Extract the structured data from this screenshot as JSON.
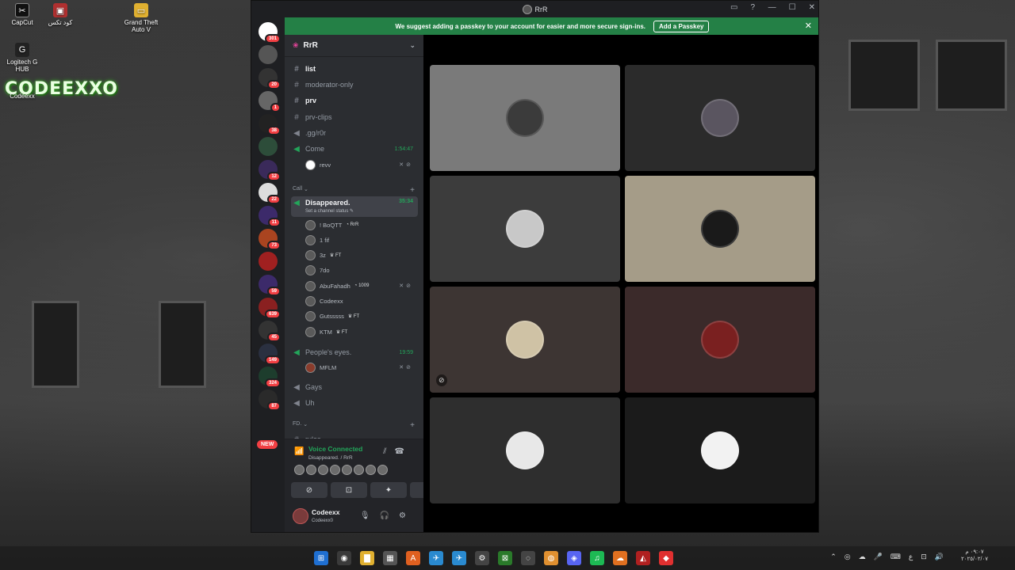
{
  "desktop": {
    "icons": [
      {
        "label": "CapCut",
        "glyph": "✂"
      },
      {
        "label": "كود تكس",
        "glyph": "▣"
      },
      {
        "label": "Grand Theft Auto V",
        "glyph": "▭"
      },
      {
        "label": "Logitech G HUB",
        "glyph": "G"
      },
      {
        "label": "Codeexx",
        "glyph": "●"
      }
    ],
    "wallpaper_logo": "CODEEXXO"
  },
  "window": {
    "title": "RrR",
    "controls": {
      "minimize": "—",
      "maximize": "☐",
      "close": "✕"
    },
    "extras": {
      "inbox": "▭",
      "help": "?"
    }
  },
  "banner": {
    "text": "We suggest adding a passkey to your account for easier and more secure sign-ins.",
    "button": "Add a Passkey",
    "close": "✕"
  },
  "servers": [
    {
      "badge": "301"
    },
    {
      "badge": ""
    },
    {
      "badge": "20"
    },
    {
      "badge": "1"
    },
    {
      "badge": "38"
    },
    {
      "badge": ""
    },
    {
      "badge": "12"
    },
    {
      "badge": "22"
    },
    {
      "badge": "11"
    },
    {
      "badge": "73"
    },
    {
      "badge": ""
    },
    {
      "badge": "59"
    },
    {
      "badge": "639"
    },
    {
      "badge": "45"
    },
    {
      "badge": "149"
    },
    {
      "badge": "324"
    },
    {
      "badge": "87"
    }
  ],
  "servers_new": "NEW",
  "guild": {
    "name": "RrR",
    "chevron": "⌄"
  },
  "channels": [
    {
      "type": "text",
      "name": "list",
      "bright": true
    },
    {
      "type": "text",
      "name": "moderator-only",
      "bright": false
    },
    {
      "type": "text",
      "name": "prv",
      "bright": true
    },
    {
      "type": "text",
      "name": "prv-clips",
      "bright": false
    },
    {
      "type": "text",
      "name": ".gg/r0r",
      "bright": false
    },
    {
      "type": "voice",
      "name": "Come",
      "time": "1:54:47"
    }
  ],
  "come_members": [
    {
      "name": "revv",
      "icons": "✕⊘"
    }
  ],
  "category_call": "Call",
  "selected_channel": {
    "name": "Disappeared.",
    "time": "35:34",
    "status_hint": "Set a channel status ✎"
  },
  "call_members": [
    {
      "name": "! BoQTT",
      "tag": "RrR",
      "tag_icon": "◔",
      "icons": ""
    },
    {
      "name": "1 fif",
      "tag": "",
      "tag_icon": "",
      "icons": ""
    },
    {
      "name": "3z",
      "tag": "FT",
      "tag_icon": "♛",
      "icons": ""
    },
    {
      "name": "7do",
      "tag": "",
      "tag_icon": "",
      "icons": ""
    },
    {
      "name": "AbuFahadh",
      "tag": "1009",
      "tag_icon": "◔",
      "icons": "✕⊘"
    },
    {
      "name": "Codeexx",
      "tag": "",
      "tag_icon": "",
      "icons": ""
    },
    {
      "name": "Gutsssss",
      "tag": "FT",
      "tag_icon": "♛",
      "icons": ""
    },
    {
      "name": "KTM",
      "tag": "FT",
      "tag_icon": "♛",
      "icons": ""
    }
  ],
  "peoples_eyes": {
    "name": "People's eyes.",
    "time": "19:59"
  },
  "peoples_members": [
    {
      "name": "MFLM",
      "icons": "✕⊘"
    }
  ],
  "more_channels": [
    {
      "type": "voice",
      "name": "Gays"
    },
    {
      "type": "voice",
      "name": "Uh"
    }
  ],
  "category_fd": "FD.",
  "partial_channel": "rules",
  "voice_panel": {
    "status": "Voice Connected",
    "location": "Disappeared. / RrR",
    "avatar_count": 8,
    "buttons": [
      "⊘",
      "⊡",
      "✦",
      "✋"
    ]
  },
  "user": {
    "name": "Codeexx",
    "status": "Codeexx0"
  },
  "tiles": [
    {
      "bg": "#7a7a7a",
      "av": "#3b3b3b"
    },
    {
      "bg": "#2b2b2b",
      "av": "#5a5560"
    },
    {
      "bg": "#3c3c3c",
      "av": "#c8c8c8"
    },
    {
      "bg": "#a59c88",
      "av": "#1a1a1a"
    },
    {
      "bg": "#3d3533",
      "av": "#cfc2a5"
    },
    {
      "bg": "#3b2a2a",
      "av": "#7a2020"
    },
    {
      "bg": "#2e2e2e",
      "av": "#e8e8e8"
    },
    {
      "bg": "#1b1b1b",
      "av": "#f2f2f2"
    }
  ],
  "taskbar": {
    "apps": [
      "⊞",
      "◉",
      "▇",
      "▦",
      "A",
      "✈",
      "✈",
      "⚙",
      "⊠",
      "◌",
      "◍",
      "◈",
      "♫",
      "☁",
      "◭",
      "◆"
    ],
    "tray": [
      "⌃",
      "◎",
      "☁",
      "🎤",
      "⌨",
      "ع",
      "⊡",
      "🔊"
    ],
    "time": "٠٩:٠٧ م",
    "date": "٢٠٢٥/٠٢/٠٧"
  }
}
